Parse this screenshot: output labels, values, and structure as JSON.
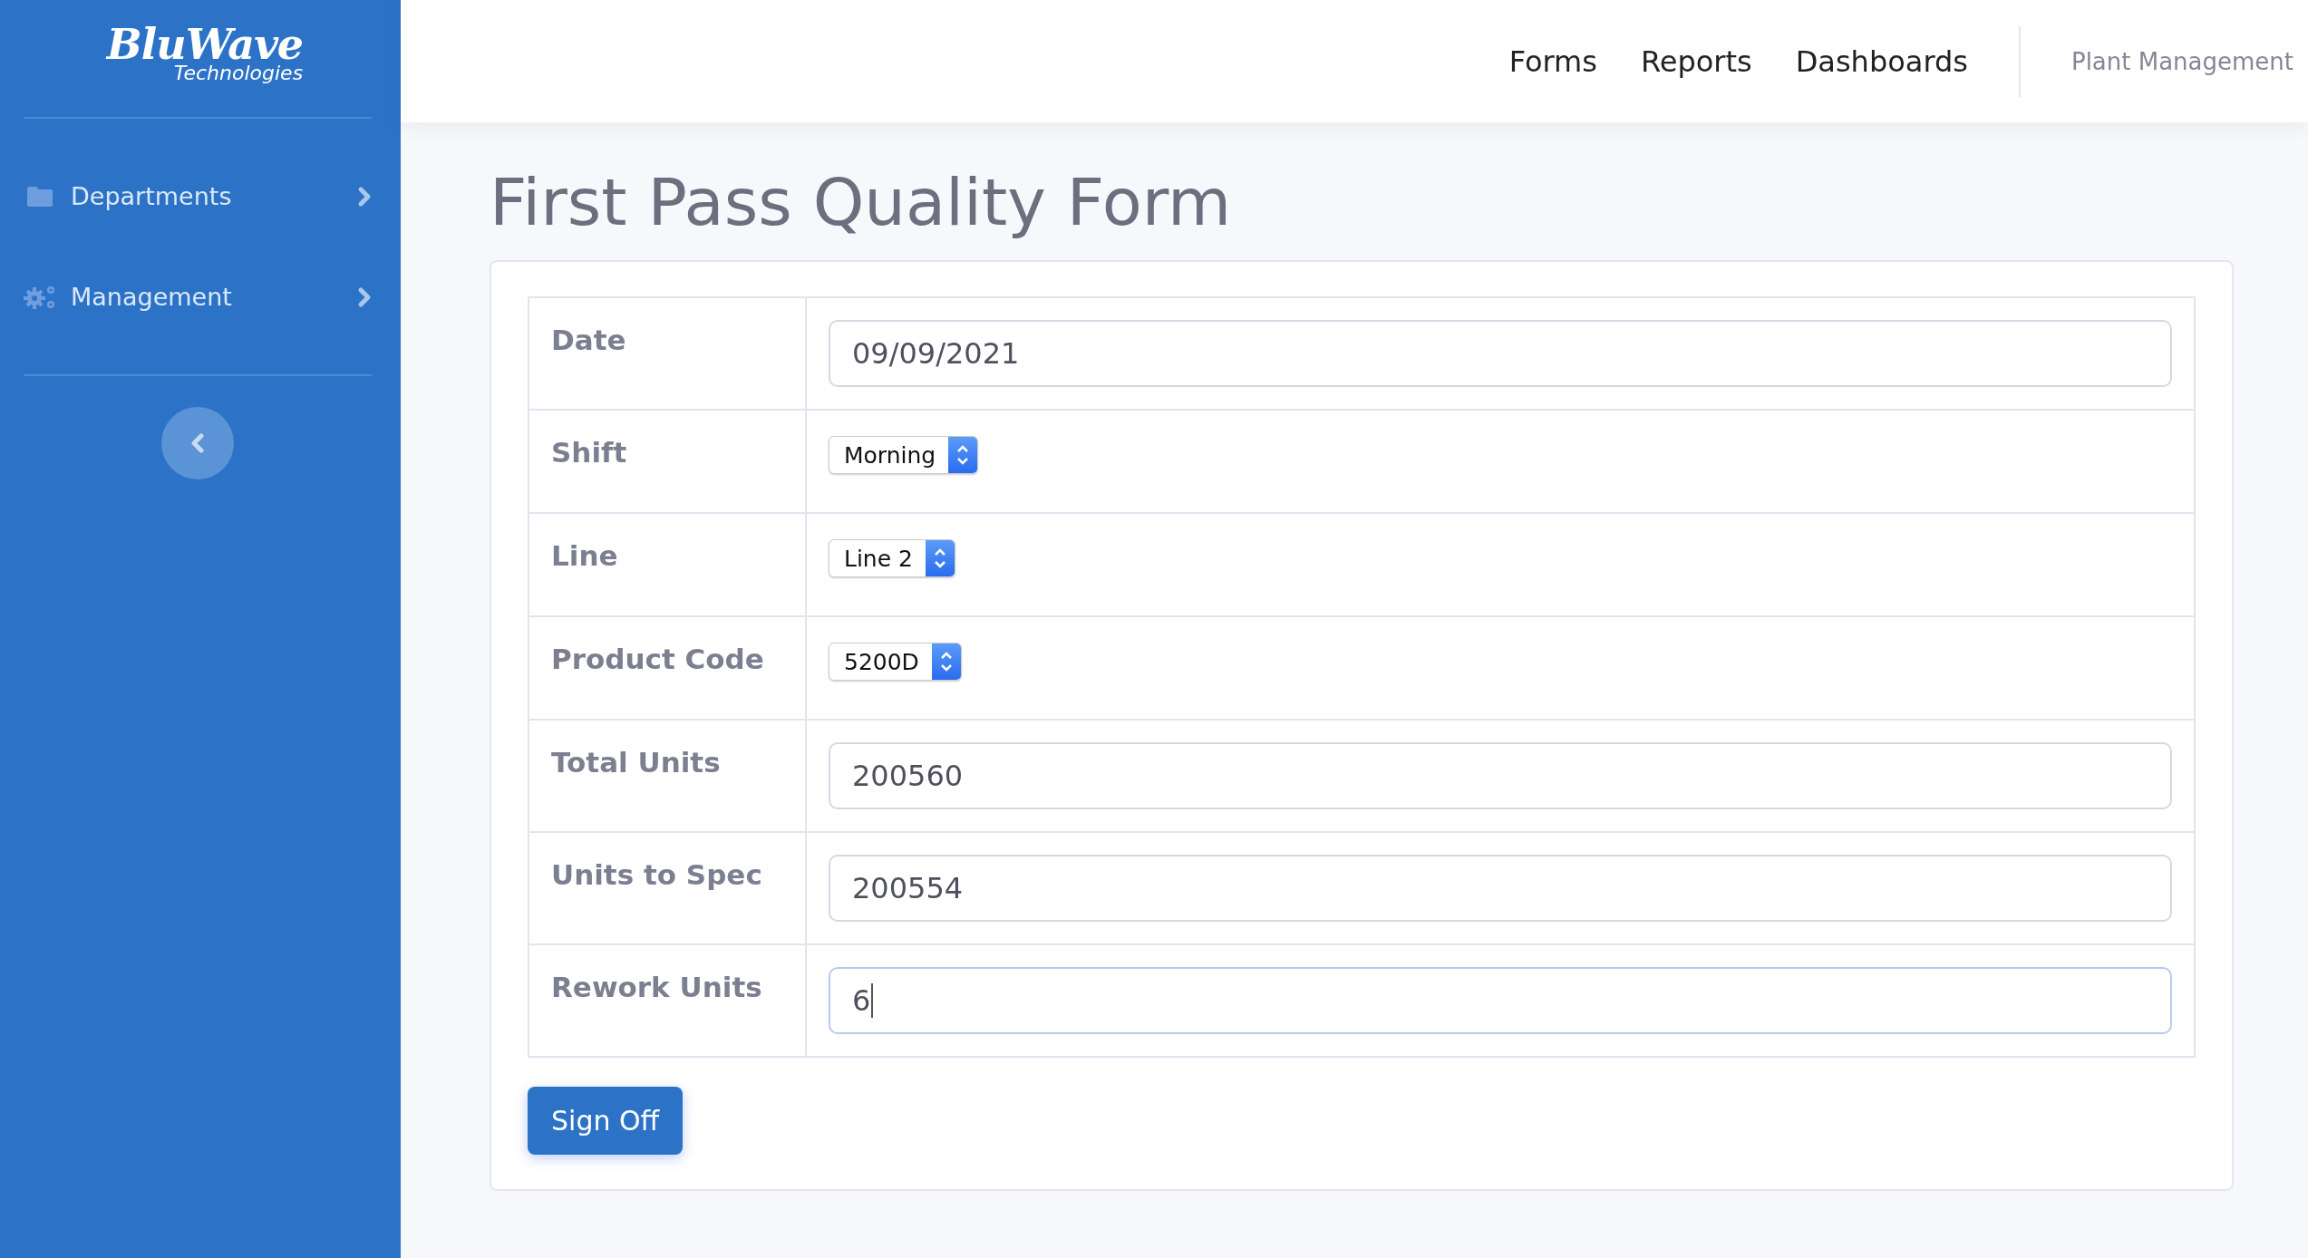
{
  "sidebar": {
    "logo": {
      "name": "BluWave",
      "tagline": "Technologies"
    },
    "items": [
      {
        "label": "Departments",
        "kind": "folder"
      },
      {
        "label": "Management",
        "kind": "gears"
      }
    ]
  },
  "topbar": {
    "links": [
      "Forms",
      "Reports",
      "Dashboards"
    ],
    "context": "Plant Management"
  },
  "title": "First Pass Quality Form",
  "fields": [
    {
      "label": "Date",
      "kind": "text",
      "value": "09/09/2021",
      "focused": false
    },
    {
      "label": "Shift",
      "kind": "select",
      "value": "Morning"
    },
    {
      "label": "Line",
      "kind": "select",
      "value": "Line 2"
    },
    {
      "label": "Product Code",
      "kind": "select",
      "value": "5200D"
    },
    {
      "label": "Total Units",
      "kind": "text",
      "value": "200560",
      "focused": false
    },
    {
      "label": "Units to Spec",
      "kind": "text",
      "value": "200554",
      "focused": false
    },
    {
      "label": "Rework Units",
      "kind": "text",
      "value": "6",
      "focused": true
    }
  ],
  "submit": "Sign Off"
}
